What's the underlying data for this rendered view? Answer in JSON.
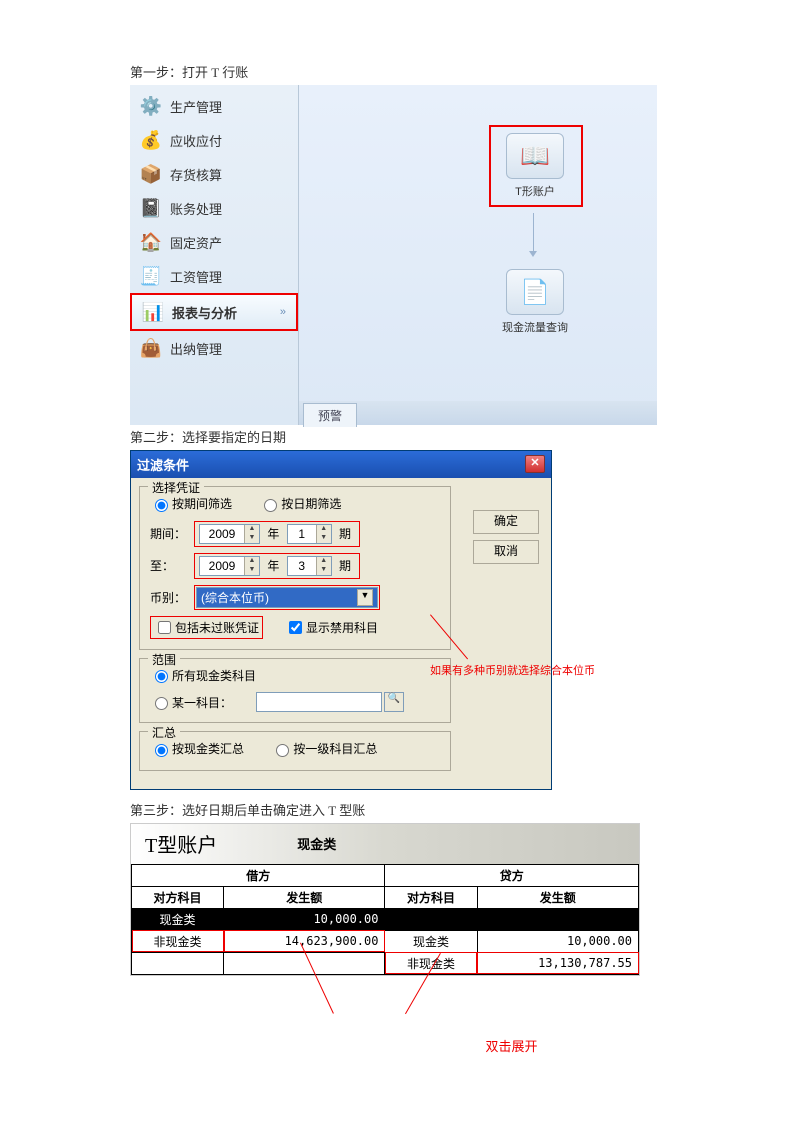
{
  "steps": {
    "s1": "第一步：打开 T 行账",
    "s2": "第二步：选择要指定的日期",
    "s3": "第三步：选好日期后单击确定进入 T 型账"
  },
  "sidebar": {
    "items": [
      {
        "label": "生产管理",
        "icon": "⚙️"
      },
      {
        "label": "应收应付",
        "icon": "💰"
      },
      {
        "label": "存货核算",
        "icon": "📦"
      },
      {
        "label": "账务处理",
        "icon": "📓"
      },
      {
        "label": "固定资产",
        "icon": "🏠"
      },
      {
        "label": "工资管理",
        "icon": "🧾"
      },
      {
        "label": "报表与分析",
        "icon": "📊",
        "active": true,
        "arrow": "»"
      },
      {
        "label": "出纳管理",
        "icon": "👜"
      }
    ]
  },
  "main1": {
    "tile1": "T形账户",
    "tile2": "现金流量查询",
    "tab": "预警"
  },
  "dlg": {
    "title": "过滤条件",
    "fs1": "选择凭证",
    "r1": "按期间筛选",
    "r2": "按日期筛选",
    "period": "期间：",
    "to": "至：",
    "y1": "2009",
    "yy": "年",
    "m1": "1",
    "m2": "3",
    "pp": "期",
    "currency_lbl": "币别：",
    "currency_val": "(综合本位币)",
    "cb1": "包括未过账凭证",
    "cb2": "显示禁用科目",
    "fs2": "范围",
    "r3": "所有现金类科目",
    "r4": "某一科目：",
    "fs3": "汇总",
    "r5": "按现金类汇总",
    "r6": "按一级科目汇总",
    "ok": "确定",
    "cancel": "取消",
    "annot": "如果有多种币别就选择综合本位币"
  },
  "tacc": {
    "title": "T型账户",
    "sub": "现金类",
    "debit": "借方",
    "credit": "贷方",
    "col1": "对方科目",
    "col2": "发生额",
    "rows_d": [
      {
        "name": "现金类",
        "amt": "10,000.00",
        "black": true
      },
      {
        "name": "非现金类",
        "amt": "14,623,900.00",
        "red": true
      }
    ],
    "rows_c": [
      {
        "name": "现金类",
        "amt": "10,000.00"
      },
      {
        "name": "非现金类",
        "amt": "13,130,787.55",
        "red": true
      }
    ],
    "annot": "双击展开"
  }
}
